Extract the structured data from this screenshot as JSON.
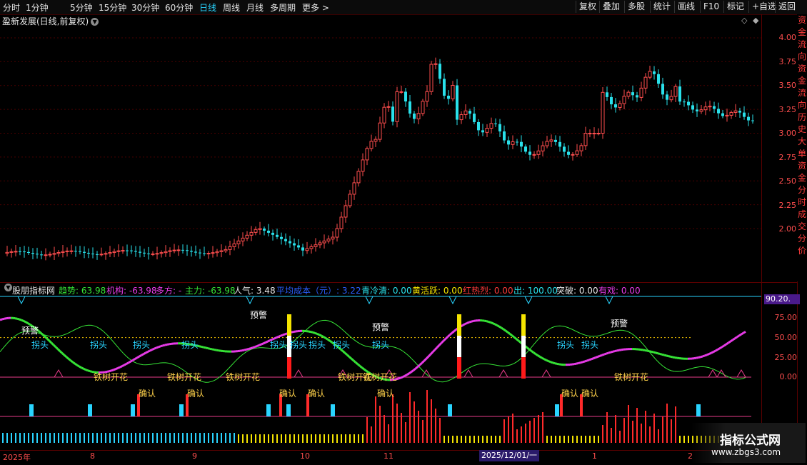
{
  "topbar": {
    "periods": [
      "分时",
      "1分钟",
      "5分钟",
      "15分钟",
      "30分钟",
      "60分钟",
      "日线",
      "周线",
      "月线",
      "多周期",
      "更多 >"
    ],
    "active_period": "日线",
    "right_buttons": [
      "复权",
      "叠加",
      "多股",
      "统计",
      "画线",
      "F10",
      "标记",
      "+自选",
      "返回"
    ]
  },
  "main_chart": {
    "title": "盈新发展(日线,前复权)",
    "y_ticks": [
      "4.00",
      "3.75",
      "3.50",
      "3.25",
      "3.00",
      "2.75",
      "2.50",
      "2.25",
      "2.00"
    ],
    "up_color": "#ff4e4e",
    "down_color": "#29e0ea"
  },
  "side_strip": {
    "text": "资金流向资金流向历史大单资金分时成交分价"
  },
  "indicator": {
    "name": "股朋指标网",
    "fields": [
      {
        "label": "趋势: 63.98",
        "color": "#36e336"
      },
      {
        "label": "机构: -63.98",
        "color": "#e83be8"
      },
      {
        "label": "多方: -",
        "color": "#e83be8"
      },
      {
        "label": "主力: -63.98",
        "color": "#36e336"
      },
      {
        "label": "人气: 3.48",
        "color": "#e6e6e6"
      },
      {
        "label": "平均成本（元）: 3.22",
        "color": "#2a5fff"
      },
      {
        "label": "青冷清: 0.00",
        "color": "#29e0ea"
      },
      {
        "label": "黄活跃: 0.00",
        "color": "#f5e400"
      },
      {
        "label": "红热烈: 0.00",
        "color": "#ff3b3b"
      },
      {
        "label": "出: 100.00",
        "color": "#29e0ea"
      },
      {
        "label": "突破: 0.00",
        "color": "#e6e6e6"
      },
      {
        "label": "有戏: 0.00",
        "color": "#e83be8"
      }
    ],
    "badge": "90.20.",
    "y_ticks": [
      "75.00",
      "50.00",
      "25.00",
      "0.00"
    ],
    "labels": {
      "warn": "预警",
      "turn": "拐头",
      "bloom": "铁树开花",
      "confirm": "确认"
    }
  },
  "x_axis": {
    "labels": [
      "2025年",
      "8",
      "9",
      "10",
      "11",
      "2025/12/01/一",
      "1",
      "2"
    ]
  },
  "watermark": {
    "title": "指标公式网",
    "url": "www.zbgs3.com"
  }
}
